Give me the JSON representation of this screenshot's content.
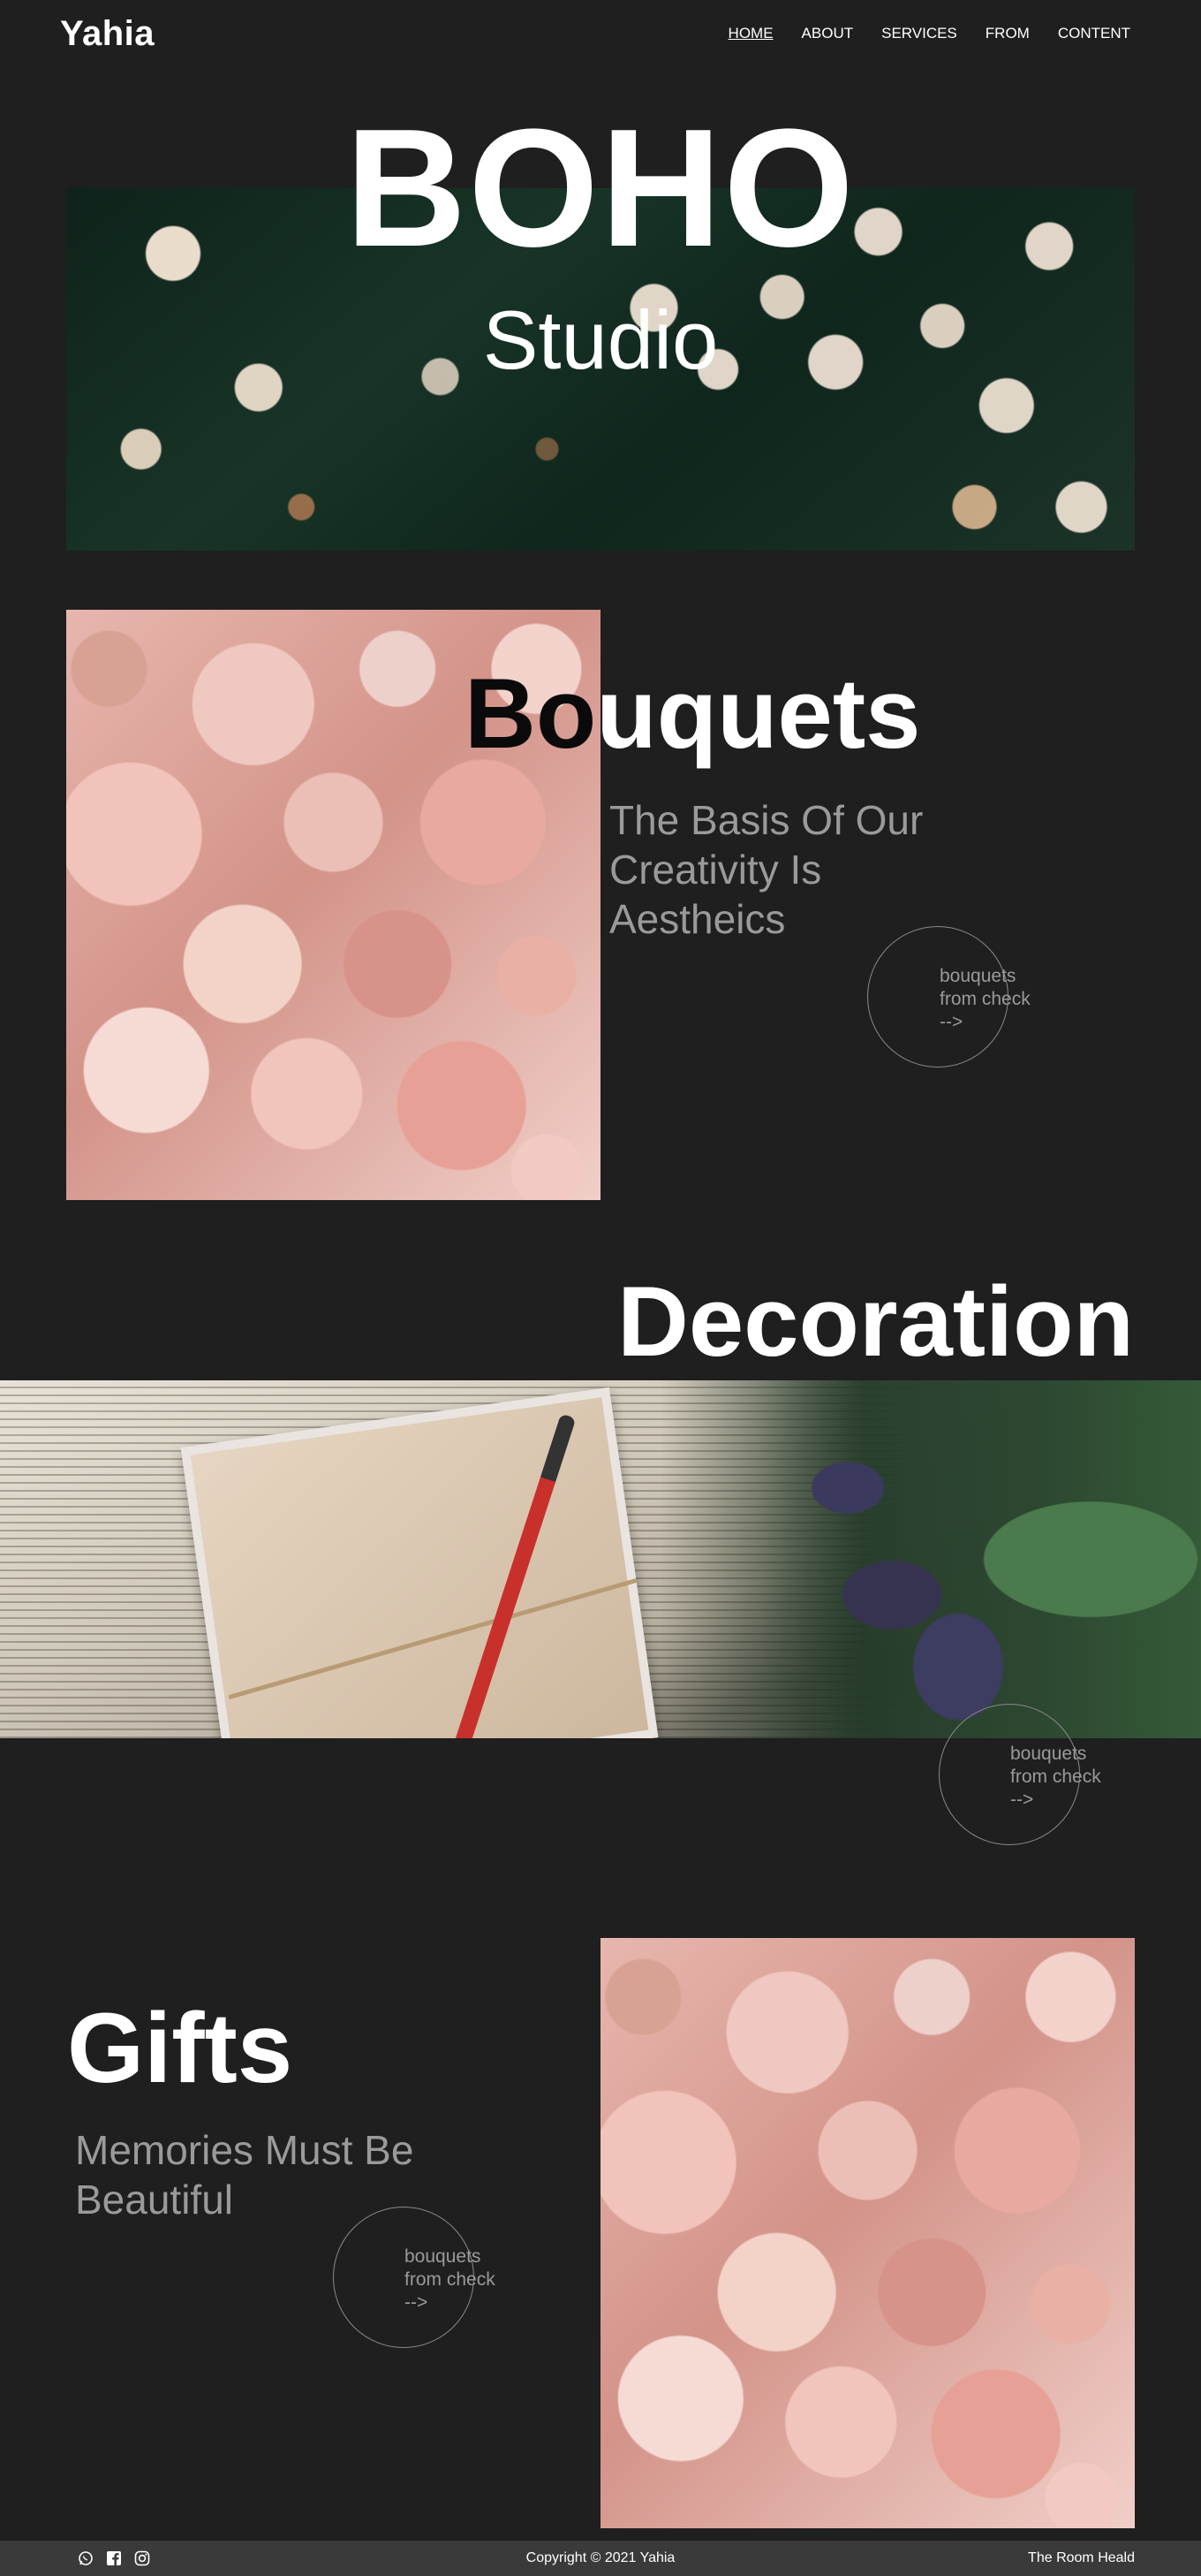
{
  "header": {
    "logo": "Yahia",
    "nav": [
      "HOME",
      "ABOUT",
      "SERVICES",
      "FROM",
      "CONTENT"
    ]
  },
  "hero": {
    "title": "BOHO",
    "subtitle": "Studio"
  },
  "bouquets": {
    "title_dark_part": "Bo",
    "title_light_part": "uquets",
    "subtitle": "The Basis Of Our Creativity Is Aestheics",
    "cta": [
      "bouquets",
      "from check",
      "-->"
    ]
  },
  "decoration": {
    "title": "Decoration",
    "cta": [
      "bouquets",
      "from check",
      "-->"
    ]
  },
  "gifts": {
    "title": "Gifts",
    "subtitle": "Memories Must Be Beautiful",
    "cta": [
      "bouquets",
      "from check",
      "-->"
    ]
  },
  "footer": {
    "icons": [
      "whatsapp-icon",
      "facebook-icon",
      "instagram-icon"
    ],
    "copyright": "Copyright © 2021 Yahia",
    "right_text": "The Room Heald"
  }
}
